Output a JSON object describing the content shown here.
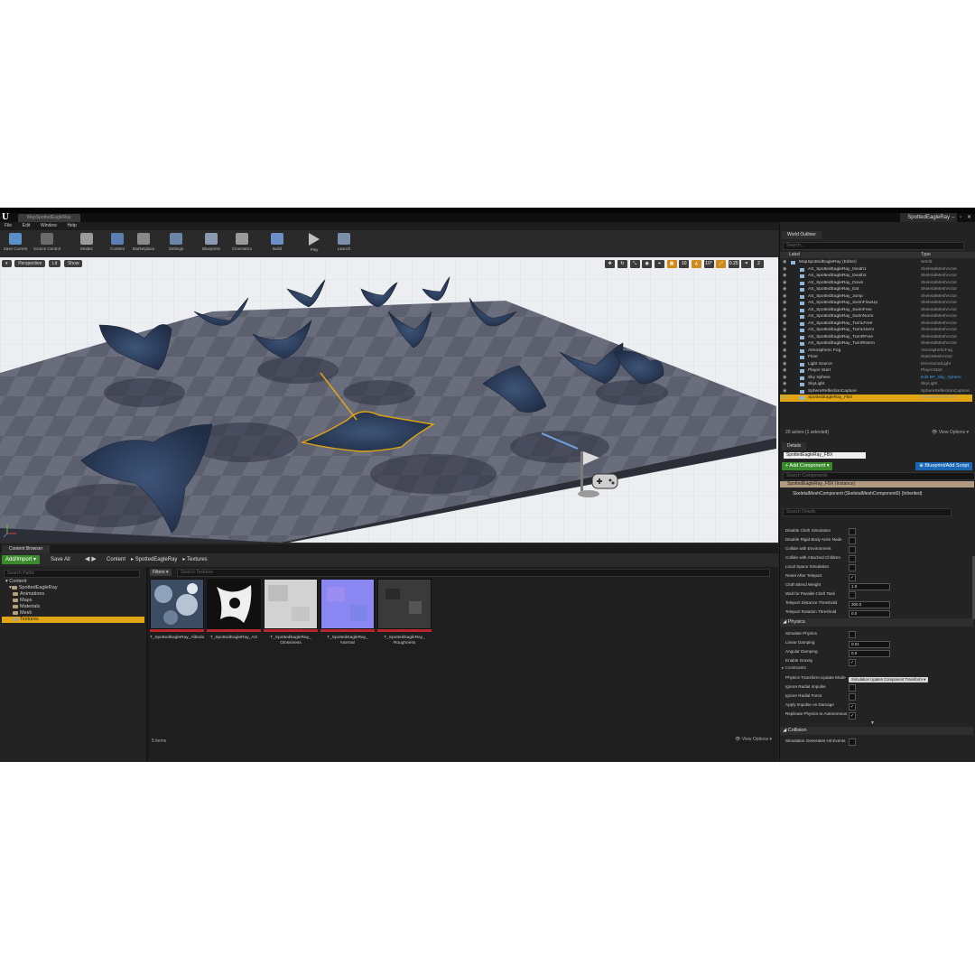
{
  "titlebar": {
    "logo": "U",
    "doc_tab": "MapSpottedEagleRay",
    "project": "SpottedEagleRay",
    "window_buttons": "– ▫ ✕"
  },
  "menu": [
    "File",
    "Edit",
    "Window",
    "Help"
  ],
  "toolbar": [
    {
      "label": "Save Current",
      "color": "#5b8fc7"
    },
    {
      "label": "Source Control",
      "color": "#6a6a6a"
    },
    {
      "label": "Modes",
      "color": "#9a9a9a"
    },
    {
      "label": "Content",
      "color": "#5b7fb0"
    },
    {
      "label": "Marketplace",
      "color": "#8a8a8a"
    },
    {
      "label": "Settings",
      "color": "#6c86a8"
    },
    {
      "label": "Blueprints",
      "color": "#8a9ab0"
    },
    {
      "label": "Cinematics",
      "color": "#9a9a9a"
    },
    {
      "label": "Build",
      "color": "#6b8fc7"
    },
    {
      "label": "Play",
      "color": "#bfbfbf"
    },
    {
      "label": "Launch",
      "color": "#7a8fa8"
    }
  ],
  "viewport": {
    "dropdown": "▾",
    "perspective": "Perspective",
    "lit": "Lit",
    "show": "Show",
    "snap_grid": "10",
    "snap_angle": "10°",
    "snap_scale": "0.25",
    "camera_speed": "2"
  },
  "content_browser": {
    "tab": "Content Browser",
    "add_import": "Add/Import ▾",
    "save_all": "Save All",
    "nav": "◀ ▶",
    "breadcrumbs": [
      "Content",
      "SpottedEagleRay",
      "Textures"
    ],
    "search_paths_placeholder": "Search Paths",
    "tree": [
      "Content",
      "SpottedEagleRay",
      "Animations",
      "Maps",
      "Materials",
      "Mesh",
      "Textures"
    ],
    "filters": "Filters ▾",
    "search_textures_placeholder": "Search Textures",
    "assets": [
      {
        "label": "T_SpottedEagleRay_Albedo",
        "color": "#3c4c62"
      },
      {
        "label": "T_SpottedEagleRay_AO",
        "color": "#101010"
      },
      {
        "label": "T_SpottedEagleRay_\nGlossiness",
        "color": "#d2d2d2"
      },
      {
        "label": "T_SpottedEagleRay_\nNormal",
        "color": "#8a86f2"
      },
      {
        "label": "T_SpottedEagleRay_\nRoughness",
        "color": "#3a3a3a"
      }
    ],
    "items_count": "5 items",
    "view_options": "👁 View Options ▾"
  },
  "outliner": {
    "tab": "World Outliner",
    "search_placeholder": "Search...",
    "col_label": "Label",
    "col_type": "Type",
    "rows": [
      {
        "label": "MapSpottedEagleRay (Editor)",
        "type": "World",
        "indent": 0
      },
      {
        "label": "AS_SpottedEagleRay_Death1",
        "type": "SkeletalMeshActor",
        "indent": 1
      },
      {
        "label": "AS_SpottedEagleRay_Death2",
        "type": "SkeletalMeshActor",
        "indent": 1
      },
      {
        "label": "AS_SpottedEagleRay_Down",
        "type": "SkeletalMeshActor",
        "indent": 1
      },
      {
        "label": "AS_SpottedEagleRay_Eat",
        "type": "SkeletalMeshActor",
        "indent": 1
      },
      {
        "label": "AS_SpottedEagleRay_Jump",
        "type": "SkeletalMeshActor",
        "indent": 1
      },
      {
        "label": "AS_SpottedEagleRay_SwimFlowUp",
        "type": "SkeletalMeshActor",
        "indent": 1
      },
      {
        "label": "AS_SpottedEagleRay_SwimFree",
        "type": "SkeletalMeshActor",
        "indent": 1
      },
      {
        "label": "AS_SpottedEagleRay_SwimNorm",
        "type": "SkeletalMeshActor",
        "indent": 1
      },
      {
        "label": "AS_SpottedEagleRay_TurnLFree",
        "type": "SkeletalMeshActor",
        "indent": 1
      },
      {
        "label": "AS_SpottedEagleRay_TurnLNorm",
        "type": "SkeletalMeshActor",
        "indent": 1
      },
      {
        "label": "AS_SpottedEagleRay_TurnRFree",
        "type": "SkeletalMeshActor",
        "indent": 1
      },
      {
        "label": "AS_SpottedEagleRay_TurnRNorm",
        "type": "SkeletalMeshActor",
        "indent": 1
      },
      {
        "label": "Atmospheric Fog",
        "type": "AtmosphericFog",
        "indent": 1
      },
      {
        "label": "Floor",
        "type": "StaticMeshActor",
        "indent": 1
      },
      {
        "label": "Light Source",
        "type": "DirectionalLight",
        "indent": 1
      },
      {
        "label": "Player Start",
        "type": "PlayerStart",
        "indent": 1
      },
      {
        "label": "Sky Sphere",
        "type": "Edit BP_Sky_Sphere",
        "indent": 1,
        "link": true
      },
      {
        "label": "SkyLight",
        "type": "SkyLight",
        "indent": 1
      },
      {
        "label": "SphereReflectionCapture",
        "type": "SphereReflectionCapture",
        "indent": 1
      },
      {
        "label": "SpottedEagleRay_FBX",
        "type": "SkeletalMeshActor",
        "indent": 1,
        "selected": true
      }
    ],
    "actors_count": "20 actors (1 selected)",
    "view_options": "👁 View Options ▾"
  },
  "details": {
    "tab": "Details",
    "actor_name": "SpottedEagleRay_FBX",
    "add_component": "+ Add Component ▾",
    "blueprint_script": "⊕ Blueprint/Add Script",
    "search_components_placeholder": "Search Components",
    "components": [
      "SpottedEagleRay_FBX (Instance)",
      "SkeletalMeshComponent (SkeletalMeshComponent0) (Inherited)"
    ],
    "search_details_placeholder": "Search Details",
    "cloth_props": [
      {
        "label": "Disable Cloth Simulation",
        "kind": "check",
        "value": ""
      },
      {
        "label": "Disable Rigid Body Anim Node",
        "kind": "check",
        "value": ""
      },
      {
        "label": "Collide with Environment",
        "kind": "check",
        "value": ""
      },
      {
        "label": "Collide with Attached Children",
        "kind": "check",
        "value": ""
      },
      {
        "label": "Local Space Simulation",
        "kind": "check",
        "value": ""
      },
      {
        "label": "Reset After Teleport",
        "kind": "check",
        "value": "✓"
      },
      {
        "label": "Cloth Blend Weight",
        "kind": "num",
        "value": "1.0"
      },
      {
        "label": "Wait for Parallel Cloth Task",
        "kind": "check",
        "value": ""
      },
      {
        "label": "Teleport Distance Threshold",
        "kind": "num",
        "value": "300.0"
      },
      {
        "label": "Teleport Rotation Threshold",
        "kind": "num",
        "value": "0.0"
      }
    ],
    "physics_title": "◢ Physics",
    "physics_props": [
      {
        "label": "Simulate Physics",
        "kind": "check",
        "value": ""
      },
      {
        "label": "Linear Damping",
        "kind": "num",
        "value": "0.01"
      },
      {
        "label": "Angular Damping",
        "kind": "num",
        "value": "0.0"
      },
      {
        "label": "Enable Gravity",
        "kind": "check",
        "value": "✓"
      }
    ],
    "constraints": "▸ Constraints",
    "physics_props2": [
      {
        "label": "Physics Transform Update Mode",
        "kind": "dd",
        "value": "Simulation Upates Component Transform ▾"
      },
      {
        "label": "Ignore Radial Impulse",
        "kind": "check",
        "value": ""
      },
      {
        "label": "Ignore Radial Force",
        "kind": "check",
        "value": ""
      },
      {
        "label": "Apply Impulse on Damage",
        "kind": "check",
        "value": "✓"
      },
      {
        "label": "Replicate Physics to Autonomous",
        "kind": "check",
        "value": "✓"
      }
    ],
    "expand_arrow": "▼",
    "collision_title": "◢ Collision",
    "collision_props": [
      {
        "label": "Simulation Generates Hit Events",
        "kind": "check",
        "value": ""
      }
    ]
  }
}
